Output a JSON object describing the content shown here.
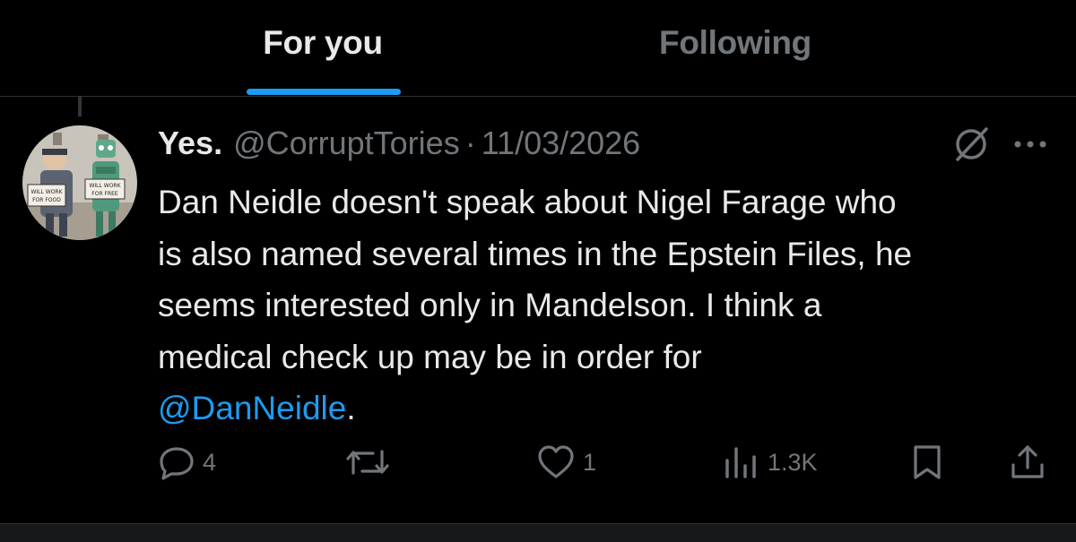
{
  "colors": {
    "background": "#000000",
    "text_primary": "#e7e9ea",
    "text_secondary": "#71767b",
    "accent": "#1d9bf0",
    "divider": "#2f3336"
  },
  "tabs": [
    {
      "label": "For you",
      "active": true
    },
    {
      "label": "Following",
      "active": false
    }
  ],
  "tweet": {
    "display_name": "Yes.",
    "handle": "@CorruptTories",
    "separator": "·",
    "date": "11/03/2026",
    "text_lines": [
      "Dan Neidle doesn't speak about Nigel Farage who",
      "is also named several times in the Epstein Files, he",
      "seems interested only in Mandelson. I think a",
      "medical check up may be in order for"
    ],
    "mention": "@DanNeidle",
    "trailing": ".",
    "avatar_signs": [
      "WILL WORK FOR FOOD",
      "WILL WORK FOR FREE"
    ]
  },
  "actions": {
    "reply": {
      "icon": "reply-icon",
      "count": "4"
    },
    "repost": {
      "icon": "repost-icon",
      "count": ""
    },
    "like": {
      "icon": "heart-icon",
      "count": "1"
    },
    "views": {
      "icon": "views-icon",
      "count": "1.3K"
    },
    "bookmark": {
      "icon": "bookmark-icon"
    },
    "share": {
      "icon": "share-icon"
    }
  }
}
